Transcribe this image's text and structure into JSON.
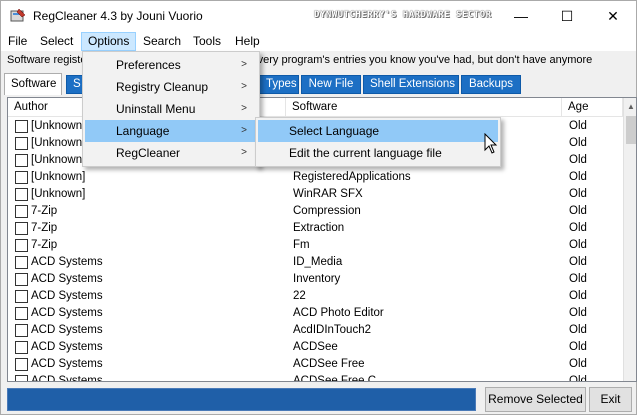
{
  "window": {
    "title": "RegCleaner 4.3 by Jouni Vuorio",
    "watermark": "DYNWUTCHERRY'S HARDWARE SECTOR",
    "minimize_glyph": "—",
    "maximize_glyph": "☐",
    "close_glyph": "✕"
  },
  "menubar": {
    "items": [
      "File",
      "Select",
      "Options",
      "Search",
      "Tools",
      "Help"
    ]
  },
  "info_line": "Software registe                                                      every program's entries you know you've had, but don't have anymore",
  "tabs": [
    "Software",
    "S",
    "Types",
    "New File",
    "Shell Extensions",
    "Backups"
  ],
  "columns": {
    "author": "Author",
    "software": "Software",
    "age": "Age"
  },
  "rows": [
    {
      "author": "[Unknown",
      "software": "",
      "age": "Old"
    },
    {
      "author": "[Unknown",
      "software": "",
      "age": "Old"
    },
    {
      "author": "[Unknown",
      "software": "",
      "age": "Old"
    },
    {
      "author": "[Unknown]",
      "software": "RegisteredApplications",
      "age": "Old"
    },
    {
      "author": "[Unknown]",
      "software": "WinRAR SFX",
      "age": "Old"
    },
    {
      "author": "7-Zip",
      "software": "Compression",
      "age": "Old"
    },
    {
      "author": "7-Zip",
      "software": "Extraction",
      "age": "Old"
    },
    {
      "author": "7-Zip",
      "software": "Fm",
      "age": "Old"
    },
    {
      "author": "ACD Systems",
      "software": "ID_Media",
      "age": "Old"
    },
    {
      "author": "ACD Systems",
      "software": "Inventory",
      "age": "Old"
    },
    {
      "author": "ACD Systems",
      "software": "22",
      "age": "Old"
    },
    {
      "author": "ACD Systems",
      "software": "ACD Photo Editor",
      "age": "Old"
    },
    {
      "author": "ACD Systems",
      "software": "AcdIDInTouch2",
      "age": "Old"
    },
    {
      "author": "ACD Systems",
      "software": "ACDSee",
      "age": "Old"
    },
    {
      "author": "ACD Systems",
      "software": "ACDSee Free",
      "age": "Old"
    },
    {
      "author": "ACD Systems",
      "software": "ACDSee Free C...",
      "age": "Old"
    }
  ],
  "options_menu": [
    {
      "label": "Preferences",
      "arrow": ">"
    },
    {
      "label": "Registry Cleanup",
      "arrow": ">"
    },
    {
      "label": "Uninstall Menu",
      "arrow": ">"
    },
    {
      "label": "Language",
      "arrow": ">"
    },
    {
      "label": "RegCleaner",
      "arrow": ">"
    }
  ],
  "language_submenu": [
    "Select Language",
    "Edit the current language file"
  ],
  "buttons": {
    "remove_selected": "Remove Selected",
    "exit": "Exit"
  },
  "colors": {
    "tab_blue": "#1c6fc4",
    "menu_highlight": "#91c9f7",
    "progress_blue": "#1f5fa8"
  }
}
